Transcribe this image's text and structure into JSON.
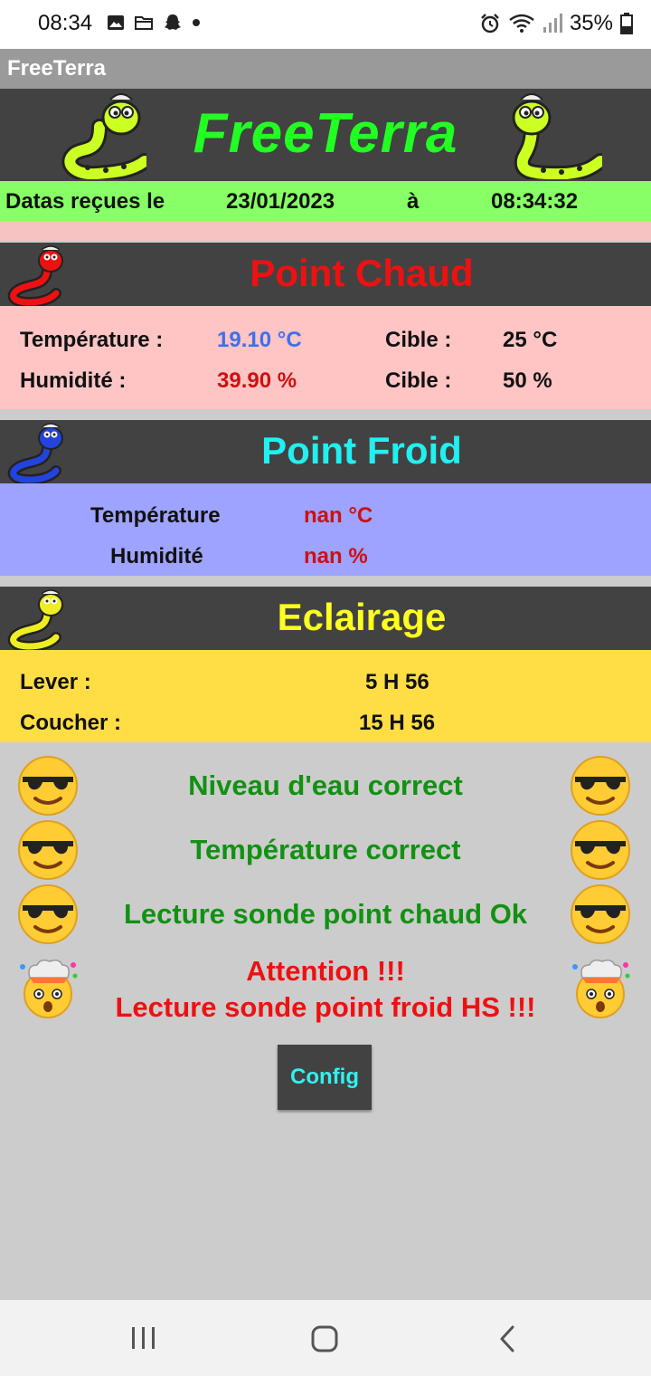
{
  "status_bar": {
    "time": "08:34",
    "battery": "35%",
    "icons_left": [
      "gallery-icon",
      "folder-icon",
      "snapchat-icon",
      "dot-icon"
    ],
    "icons_right": [
      "alarm-icon",
      "wifi-icon",
      "signal-icon",
      "battery-icon"
    ]
  },
  "app_bar": {
    "title": "FreeTerra"
  },
  "header": {
    "title": "FreeTerra"
  },
  "date_row": {
    "label": "Datas reçues le",
    "date": "23/01/2023",
    "at": "à",
    "time": "08:34:32"
  },
  "point_chaud": {
    "title": "Point Chaud",
    "temp_label": "Température :",
    "temp_value": "19.10 °C",
    "temp_target_label": "Cible :",
    "temp_target_value": "25 °C",
    "hum_label": "Humidité :",
    "hum_value": "39.90  %",
    "hum_target_label": "Cible :",
    "hum_target_value": "50  %"
  },
  "point_froid": {
    "title": "Point Froid",
    "temp_label": "Température",
    "temp_value": "nan °C",
    "hum_label": "Humidité",
    "hum_value": "nan  %"
  },
  "eclairage": {
    "title": "Eclairage",
    "lever_label": "Lever :",
    "lever_value": "5 H 56",
    "coucher_label": "Coucher :",
    "coucher_value": "15 H 56"
  },
  "messages": {
    "water": "Niveau d'eau correct",
    "temperature": "Température correct",
    "probe_hot": "Lecture sonde point chaud Ok",
    "alert_title": "Attention !!!",
    "alert_text": "Lecture sonde point froid  HS !!!"
  },
  "config_button": "Config",
  "colors": {
    "header_bg": "#424242",
    "title_green": "#22ff22",
    "chaud_red": "#ee1111",
    "froid_cyan": "#22f0f0",
    "eclairage_yellow": "#ffff22",
    "chaud_panel": "#ffc4c4",
    "froid_panel": "#9da3ff",
    "eclairage_panel": "#ffdd44",
    "ok_green": "#129112",
    "alert_red": "#ee1111"
  }
}
